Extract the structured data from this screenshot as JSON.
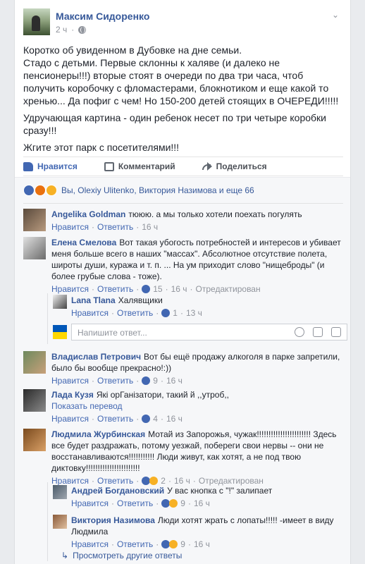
{
  "post": {
    "author": "Максим Сидоренко",
    "time": "2 ч",
    "paragraphs": [
      "Коротко об увиденном в Дубовке на дне семьи.\nСтадо с детьми. Первые склонны к халяве (и далеко не пенсионеры!!!) вторые стоят в очереди по два три часа, чтоб получить коробочку с фломастерами, блокнотиком и еще какой то хренью... Да пофиг с чем! Но 150-200 детей стоящих в ОЧЕРЕДИ!!!!!",
      "Удручающая картина - один ребенок несет по три четыре коробки сразу!!!",
      "Жгите этот парк с посетителями!!!"
    ]
  },
  "actions": {
    "like": "Нравится",
    "comment": "Комментарий",
    "share": "Поделиться"
  },
  "reactions": {
    "summary": "Вы, Olexiy Ulitenko, Виктория Назимова и еще 66"
  },
  "labels": {
    "like": "Нравится",
    "reply": "Ответить",
    "edited": "Отредактирован",
    "translate": "Показать перевод",
    "reply_placeholder": "Напишите ответ...",
    "more_replies": "Просмотреть другие ответы"
  },
  "comments": [
    {
      "name": "Angelika Goldman",
      "text": "тююю. а мы только хотели поехать погулять",
      "likes": "",
      "time": "16 ч"
    },
    {
      "name": "Елена Смелова",
      "text": "Вот такая убогость потребностей и интересов и убивает меня больше всего в наших \"массах\". Абсолютное отсутствие полета, широты души, куража и т. п. ... На ум приходит слово \"нищеброды\" (и более грубые слова - тоже).",
      "likes": "15",
      "time": "16 ч"
    },
    {
      "name": "Lana Tlana",
      "text": "Халявщики",
      "likes": "1",
      "time": "13 ч"
    },
    {
      "name": "Владислав Петрович",
      "text": "Вот бы ещё продажу алкоголя в парке запретили, было бы вообще прекрасно!:))",
      "likes": "9",
      "time": "16 ч"
    },
    {
      "name": "Лада Кузя",
      "text": "Які орГанізатори, такий й ,,утроб,,",
      "likes": "4",
      "time": "16 ч"
    },
    {
      "name": "Людмила Журбинская",
      "text": "Мотай из Запорожья, чужак!!!!!!!!!!!!!!!!!!!!!!! Здесь все будет раздражать, потому уезжай, побереги свои нервы -- они не восстанавливаются!!!!!!!!!!! Люди живут, как хотят, а не под твою диктовку!!!!!!!!!!!!!!!!!!!!!!!",
      "likes": "2",
      "time": "16 ч"
    },
    {
      "name": "Андрей Богдановский",
      "text": "У вас кнопка с \"!\" залипает",
      "likes": "9",
      "time": "16 ч"
    },
    {
      "name": "Виктория Назимова",
      "text": "Люди хотят жрать с лопаты!!!!! -имеет в виду Людмила",
      "likes": "9",
      "time": "16 ч"
    }
  ]
}
